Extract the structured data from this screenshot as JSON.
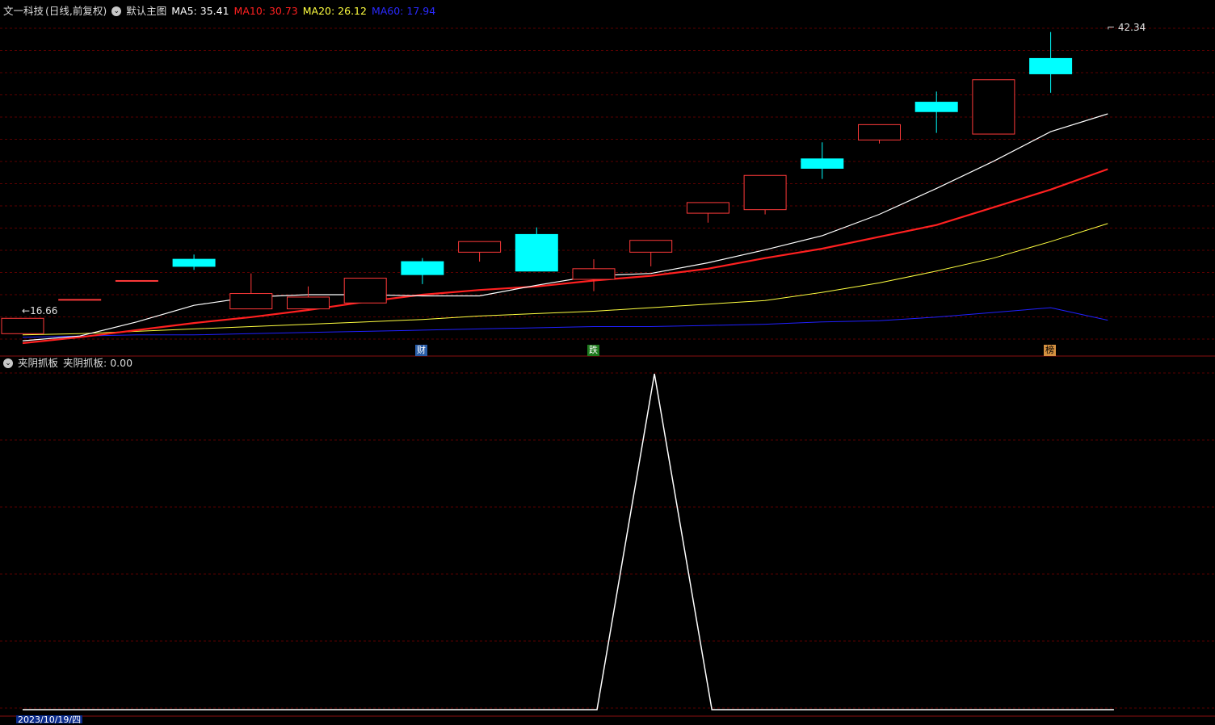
{
  "header": {
    "stock_name": "文一科技",
    "period": "(日线,前复权)",
    "main_chart_name": "默认主图",
    "ma5_label": "MA5: 35.41",
    "ma10_label": "MA10: 30.73",
    "ma20_label": "MA20: 26.12",
    "ma60_label": "MA60: 17.94"
  },
  "colors": {
    "ma5": "#ffffff",
    "ma10": "#ff2020",
    "ma20": "#ffff40",
    "ma60": "#2020ff",
    "up": "#ff3a3a",
    "down": "#00ffff",
    "grid": "#5a0000",
    "indicator": "#ffffff"
  },
  "price_labels": {
    "high": "42.34",
    "low": "16.66"
  },
  "event_tags": [
    {
      "label": "财",
      "color": "#7fc8ff"
    },
    {
      "label": "跌",
      "color": "#30c030"
    },
    {
      "label": "榜",
      "color": "#ffb060"
    }
  ],
  "indicator": {
    "name": "夹阴抓板",
    "value_label": "夹阴抓板: 0.00",
    "values": [
      0,
      0,
      0,
      0,
      0,
      0,
      0,
      0,
      0,
      0,
      0,
      1,
      0,
      0,
      0,
      0,
      0,
      0,
      0,
      0
    ]
  },
  "date_label": "2023/10/19/四",
  "chart_data": {
    "type": "candlestick",
    "price_range": [
      16.0,
      43.0
    ],
    "candles": [
      {
        "open": 16.8,
        "close": 18.1,
        "high": 18.1,
        "low": 16.8
      },
      {
        "open": 19.7,
        "close": 19.7,
        "high": 19.7,
        "low": 19.7
      },
      {
        "open": 21.3,
        "close": 21.3,
        "high": 21.3,
        "low": 21.3
      },
      {
        "open": 23.1,
        "close": 22.5,
        "high": 23.5,
        "low": 22.2
      },
      {
        "open": 18.9,
        "close": 20.2,
        "high": 21.9,
        "low": 18.9
      },
      {
        "open": 18.9,
        "close": 19.9,
        "high": 20.8,
        "low": 18.8
      },
      {
        "open": 19.4,
        "close": 21.5,
        "high": 21.5,
        "low": 19.4
      },
      {
        "open": 22.9,
        "close": 21.8,
        "high": 23.2,
        "low": 21.0
      },
      {
        "open": 23.7,
        "close": 24.6,
        "high": 24.6,
        "low": 22.9
      },
      {
        "open": 25.2,
        "close": 22.1,
        "high": 25.8,
        "low": 22.1
      },
      {
        "open": 21.4,
        "close": 22.3,
        "high": 23.1,
        "low": 20.4
      },
      {
        "open": 23.7,
        "close": 24.7,
        "high": 24.7,
        "low": 22.5
      },
      {
        "open": 27.0,
        "close": 27.9,
        "high": 27.9,
        "low": 26.2
      },
      {
        "open": 27.3,
        "close": 30.2,
        "high": 30.2,
        "low": 26.9
      },
      {
        "open": 31.6,
        "close": 30.8,
        "high": 33.0,
        "low": 29.9
      },
      {
        "open": 33.2,
        "close": 34.5,
        "high": 34.5,
        "low": 32.9
      },
      {
        "open": 36.4,
        "close": 35.6,
        "high": 37.3,
        "low": 33.8
      },
      {
        "open": 33.7,
        "close": 38.3,
        "high": 38.3,
        "low": 33.7
      },
      {
        "open": 40.1,
        "close": 38.8,
        "high": 42.34,
        "low": 37.2
      }
    ],
    "ma5": [
      16.2,
      16.6,
      17.8,
      19.2,
      19.9,
      20.1,
      20.1,
      20.0,
      20.0,
      20.9,
      21.7,
      21.9,
      22.8,
      23.9,
      25.1,
      26.9,
      29.1,
      31.4,
      33.9,
      35.41
    ],
    "ma10": [
      16.0,
      16.5,
      17.1,
      17.7,
      18.2,
      18.8,
      19.5,
      20.1,
      20.5,
      20.8,
      21.3,
      21.7,
      22.3,
      23.2,
      24.0,
      25.0,
      26.0,
      27.5,
      29.0,
      30.73
    ],
    "ma20": [
      16.7,
      16.8,
      17.0,
      17.2,
      17.4,
      17.6,
      17.8,
      18.0,
      18.3,
      18.5,
      18.7,
      19.0,
      19.3,
      19.6,
      20.3,
      21.1,
      22.1,
      23.2,
      24.6,
      26.12
    ],
    "ma60": [
      16.5,
      16.6,
      16.7,
      16.7,
      16.8,
      16.9,
      17.0,
      17.1,
      17.2,
      17.3,
      17.4,
      17.4,
      17.5,
      17.6,
      17.8,
      17.9,
      18.2,
      18.6,
      19.0,
      17.94
    ]
  }
}
